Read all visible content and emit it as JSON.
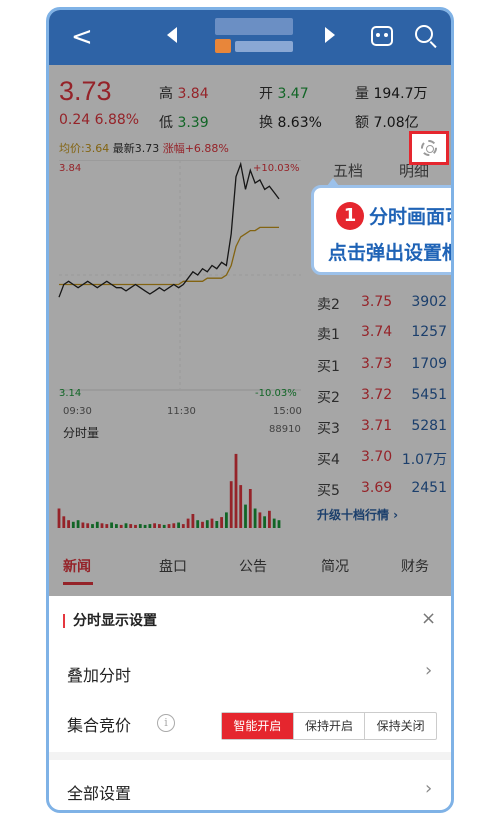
{
  "quote": {
    "price": "3.73",
    "change": "0.24 6.88%",
    "fields": [
      {
        "label": "高",
        "value": "3.84",
        "tone": "r"
      },
      {
        "label": "开",
        "value": "3.47",
        "tone": "g"
      },
      {
        "label": "量",
        "value": "194.7万",
        "tone": "k"
      },
      {
        "label": "低",
        "value": "3.39",
        "tone": "g"
      },
      {
        "label": "换",
        "value": "8.63%",
        "tone": "k"
      },
      {
        "label": "额",
        "value": "7.08亿",
        "tone": "k"
      }
    ]
  },
  "legend": {
    "avg": "均价:3.64",
    "latest": "最新3.73",
    "pct": "涨幅+6.88%"
  },
  "chart_data": {
    "type": "line",
    "price_high_label": "3.84",
    "price_low_label": "3.14",
    "pct_high_label": "+10.03%",
    "pct_low_label": "-10.03%",
    "time_labels": [
      "09:30",
      "11:30",
      "15:00"
    ],
    "ylim": [
      3.14,
      3.84
    ],
    "price": [
      3.42,
      3.46,
      3.47,
      3.46,
      3.45,
      3.46,
      3.47,
      3.46,
      3.45,
      3.46,
      3.47,
      3.46,
      3.45,
      3.45,
      3.44,
      3.45,
      3.46,
      3.45,
      3.44,
      3.43,
      3.44,
      3.45,
      3.44,
      3.45,
      3.46,
      3.45,
      3.46,
      3.48,
      3.5,
      3.49,
      3.51,
      3.5,
      3.52,
      3.51,
      3.53,
      3.52,
      3.62,
      3.8,
      3.84,
      3.76,
      3.82,
      3.78,
      3.79,
      3.76,
      3.77,
      3.75,
      3.73
    ],
    "avg": [
      3.46,
      3.46,
      3.46,
      3.46,
      3.46,
      3.46,
      3.46,
      3.46,
      3.46,
      3.46,
      3.46,
      3.46,
      3.46,
      3.46,
      3.46,
      3.46,
      3.46,
      3.46,
      3.46,
      3.46,
      3.46,
      3.46,
      3.46,
      3.46,
      3.46,
      3.46,
      3.47,
      3.47,
      3.47,
      3.47,
      3.47,
      3.48,
      3.48,
      3.48,
      3.48,
      3.49,
      3.52,
      3.58,
      3.61,
      3.62,
      3.63,
      3.63,
      3.64,
      3.64,
      3.64,
      3.64,
      3.64
    ],
    "volume_label": "分时量",
    "volume_max_label": "88910",
    "volume": [
      0.25,
      0.15,
      0.1,
      0.08,
      0.1,
      0.07,
      0.06,
      0.05,
      0.08,
      0.06,
      0.05,
      0.07,
      0.05,
      0.04,
      0.06,
      0.05,
      0.04,
      0.05,
      0.04,
      0.05,
      0.06,
      0.05,
      0.04,
      0.05,
      0.06,
      0.07,
      0.05,
      0.12,
      0.18,
      0.1,
      0.08,
      0.1,
      0.12,
      0.09,
      0.14,
      0.2,
      0.6,
      0.95,
      0.55,
      0.3,
      0.5,
      0.25,
      0.2,
      0.15,
      0.22,
      0.12,
      0.1
    ]
  },
  "order_book": {
    "tab_five": "五档",
    "tab_detail": "明细",
    "rows": [
      {
        "label": "卖2",
        "price": "3.75",
        "vol": "3902"
      },
      {
        "label": "卖1",
        "price": "3.74",
        "vol": "1257"
      },
      {
        "label": "买1",
        "price": "3.73",
        "vol": "1709"
      },
      {
        "label": "买2",
        "price": "3.72",
        "vol": "5451"
      },
      {
        "label": "买3",
        "price": "3.71",
        "vol": "5281"
      },
      {
        "label": "买4",
        "price": "3.70",
        "vol": "1.07万"
      },
      {
        "label": "买5",
        "price": "3.69",
        "vol": "2451"
      }
    ],
    "upgrade": "升级十档行情 ›"
  },
  "callout": {
    "number": "1",
    "line1": "分时画面可",
    "line2": "点击弹出设置框"
  },
  "tabs": [
    "新闻",
    "盘口",
    "公告",
    "简况",
    "财务"
  ],
  "sheet": {
    "title": "分时显示设置",
    "close": "×",
    "row_overlay": "叠加分时",
    "row_auction": "集合竞价",
    "info": "i",
    "segments": [
      "智能开启",
      "保持开启",
      "保持关闭"
    ],
    "row_all": "全部设置",
    "chevron": "›"
  },
  "colors": {
    "up": "#e5373f",
    "down": "#1b9c3b",
    "avg_line": "#c99a1c",
    "price_line": "#222222",
    "brand": "#2e63a6"
  }
}
